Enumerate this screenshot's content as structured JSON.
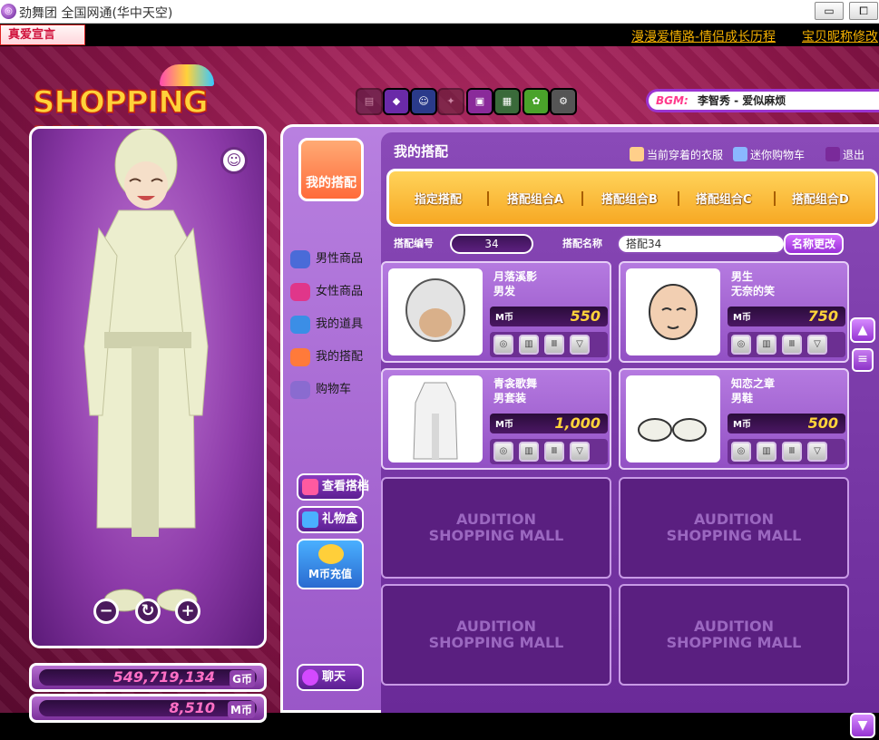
{
  "window": {
    "title": "劲舞团 全国网通(华中天空)",
    "minimize": "▭",
    "maximize": "⧠"
  },
  "announce": {
    "logo_text": "真爱宣言",
    "link1": "漫漫爱情路-情侣成长历程",
    "link2": "宝贝昵称修改"
  },
  "shop": {
    "logo": "SHOPPING MALL",
    "bgm_label": "BGM:",
    "bgm_song": "李智秀 - 爱似麻烦",
    "toolbar_icons": [
      "book-icon",
      "gem-icon",
      "smiley-icon",
      "ghost-icon",
      "tv-icon",
      "photo-icon",
      "garden-icon",
      "gear-icon"
    ]
  },
  "balance": {
    "g_amount": "549,719,134",
    "g_unit": "G币",
    "m_amount": "8,510",
    "m_unit": "M币"
  },
  "sidebar": {
    "my_outfit": "我的搭配",
    "categories": [
      {
        "label": "男性商品",
        "color": "#4a6bd8"
      },
      {
        "label": "女性商品",
        "color": "#e0368a"
      },
      {
        "label": "我的道具",
        "color": "#3b8ee6"
      },
      {
        "label": "我的搭配",
        "color": "#ff7a3a"
      },
      {
        "label": "购物车",
        "color": "#8a6bd0"
      }
    ],
    "buttons": {
      "view": "查看搭档",
      "gift": "礼物盒",
      "recharge_line1": "M币充值",
      "chat": "聊天"
    }
  },
  "panel": {
    "title": "我的搭配",
    "current_clothes": "当前穿着的衣服",
    "mini_cart": "迷你购物车",
    "exit": "退出",
    "tabs": [
      "指定搭配",
      "搭配组合A",
      "搭配组合B",
      "搭配组合C",
      "搭配组合D"
    ],
    "outfit_no_label": "搭配编号",
    "outfit_no": "34",
    "outfit_name_label": "搭配名称",
    "outfit_name": "搭配34",
    "rename": "名称更改"
  },
  "items": [
    {
      "name": "月落溪影",
      "class": "男发",
      "price": "550",
      "currency": "M币"
    },
    {
      "name": "男生",
      "class": "无奈的笑",
      "price": "750",
      "currency": "M币"
    },
    {
      "name": "青衾歌舞",
      "class": "男套装",
      "price": "1,000",
      "currency": "M币"
    },
    {
      "name": "知恋之章",
      "class": "男鞋",
      "price": "500",
      "currency": "M币"
    }
  ],
  "empty_slot": {
    "line1": "AUDITION",
    "line2": "SHOPPING MALL"
  }
}
